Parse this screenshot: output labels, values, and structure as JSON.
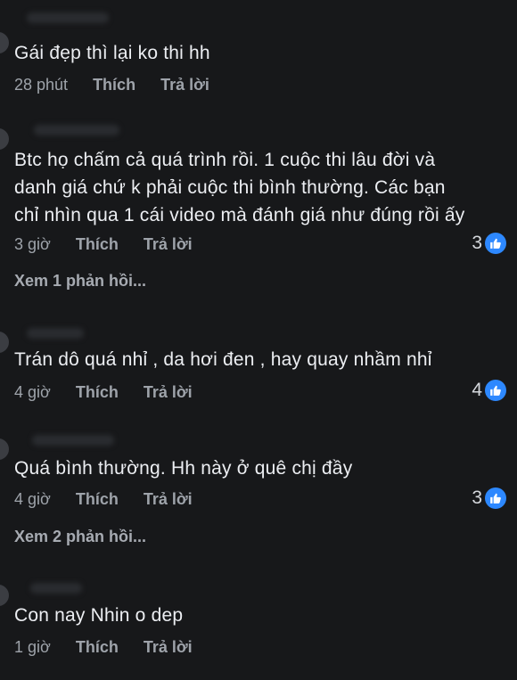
{
  "actions": {
    "like": "Thích",
    "reply": "Trả lời"
  },
  "comments": [
    {
      "text_lines": [
        "Gái đẹp thì lại ko thi hh"
      ],
      "time": "28 phút",
      "reactions": ""
    },
    {
      "text_lines": [
        "Btc họ chấm cả quá trình rồi. 1 cuộc thi lâu đời và",
        "danh giá chứ k phải cuộc thi bình thường. Các bạn",
        "chỉ nhìn qua 1 cái video mà đánh giá như đúng rồi ấy"
      ],
      "time": "3 giờ",
      "reactions": "3",
      "view_replies": "Xem 1 phản hồi..."
    },
    {
      "text_lines": [
        "Trán dô quá nhỉ , da hơi đen , hay quay nhầm nhỉ"
      ],
      "time": "4 giờ",
      "reactions": "4"
    },
    {
      "text_lines": [
        "Quá bình thường. Hh này ở quê chị đầy"
      ],
      "time": "4 giờ",
      "reactions": "3",
      "view_replies": "Xem 2 phản hồi..."
    },
    {
      "text_lines": [
        "Con nay Nhin o dep"
      ],
      "time": "1 giờ",
      "reactions": ""
    }
  ],
  "icons": {
    "reaction": "thumbs-up-icon"
  },
  "colors": {
    "background": "#17181a",
    "text": "#eceef2",
    "meta": "#9ea3aa",
    "like_badge": "#2d88ff"
  }
}
